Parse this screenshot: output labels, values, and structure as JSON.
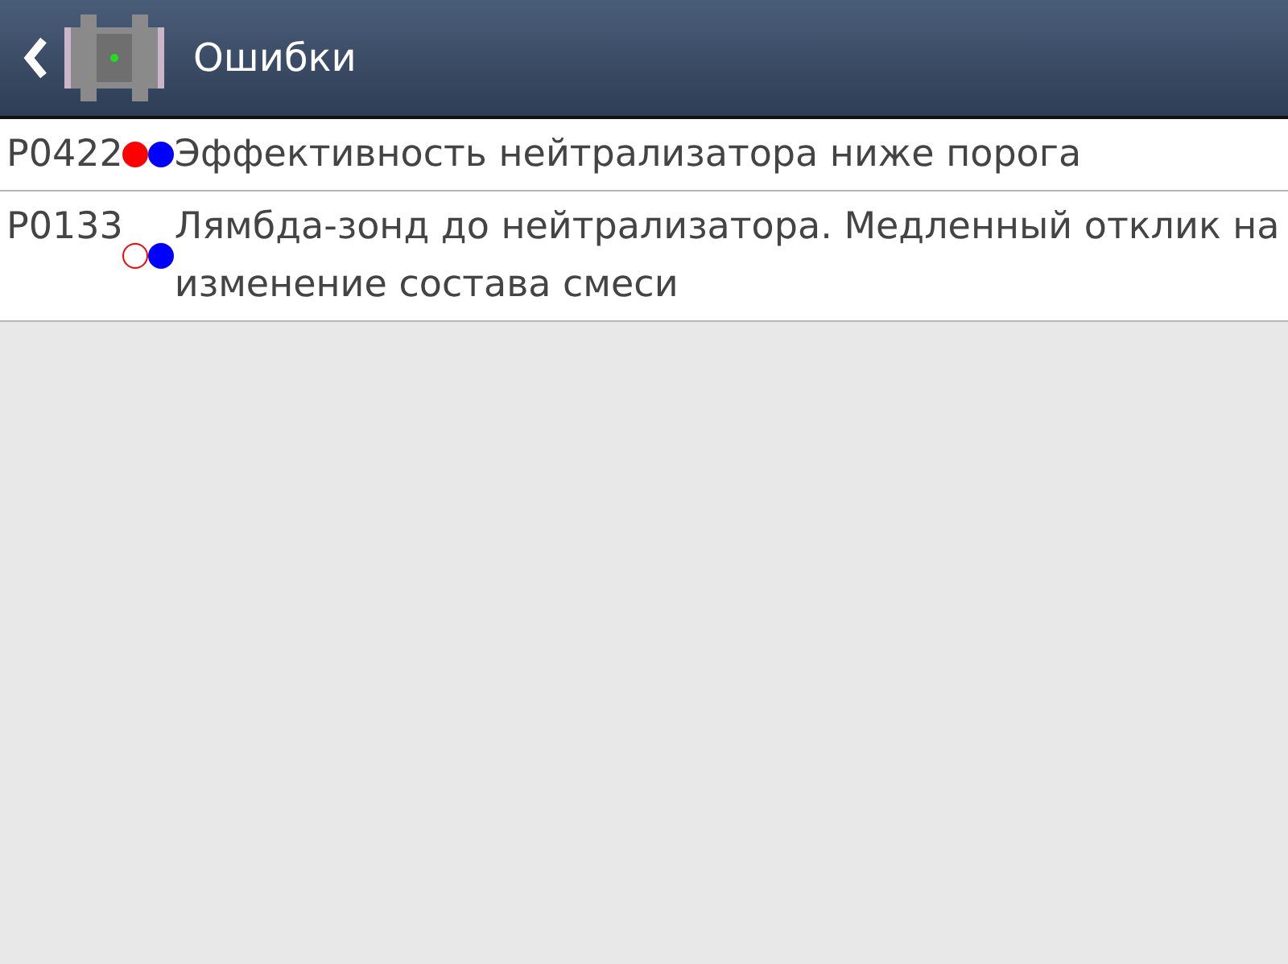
{
  "header": {
    "title": "Ошибки"
  },
  "errors": [
    {
      "code": "P0422",
      "indicators": [
        {
          "color": "#ff0000",
          "on": true
        },
        {
          "color": "#0000ff",
          "on": true
        }
      ],
      "description": "Эффективность нейтрализатора ниже порога"
    },
    {
      "code": "P0133",
      "indicators": [
        {
          "color": "#ff0000",
          "on": false
        },
        {
          "color": "#0000ff",
          "on": true
        }
      ],
      "description": "Лямбда-зонд до нейтрализатора. Медленный отклик на изменение состава смеси"
    }
  ]
}
